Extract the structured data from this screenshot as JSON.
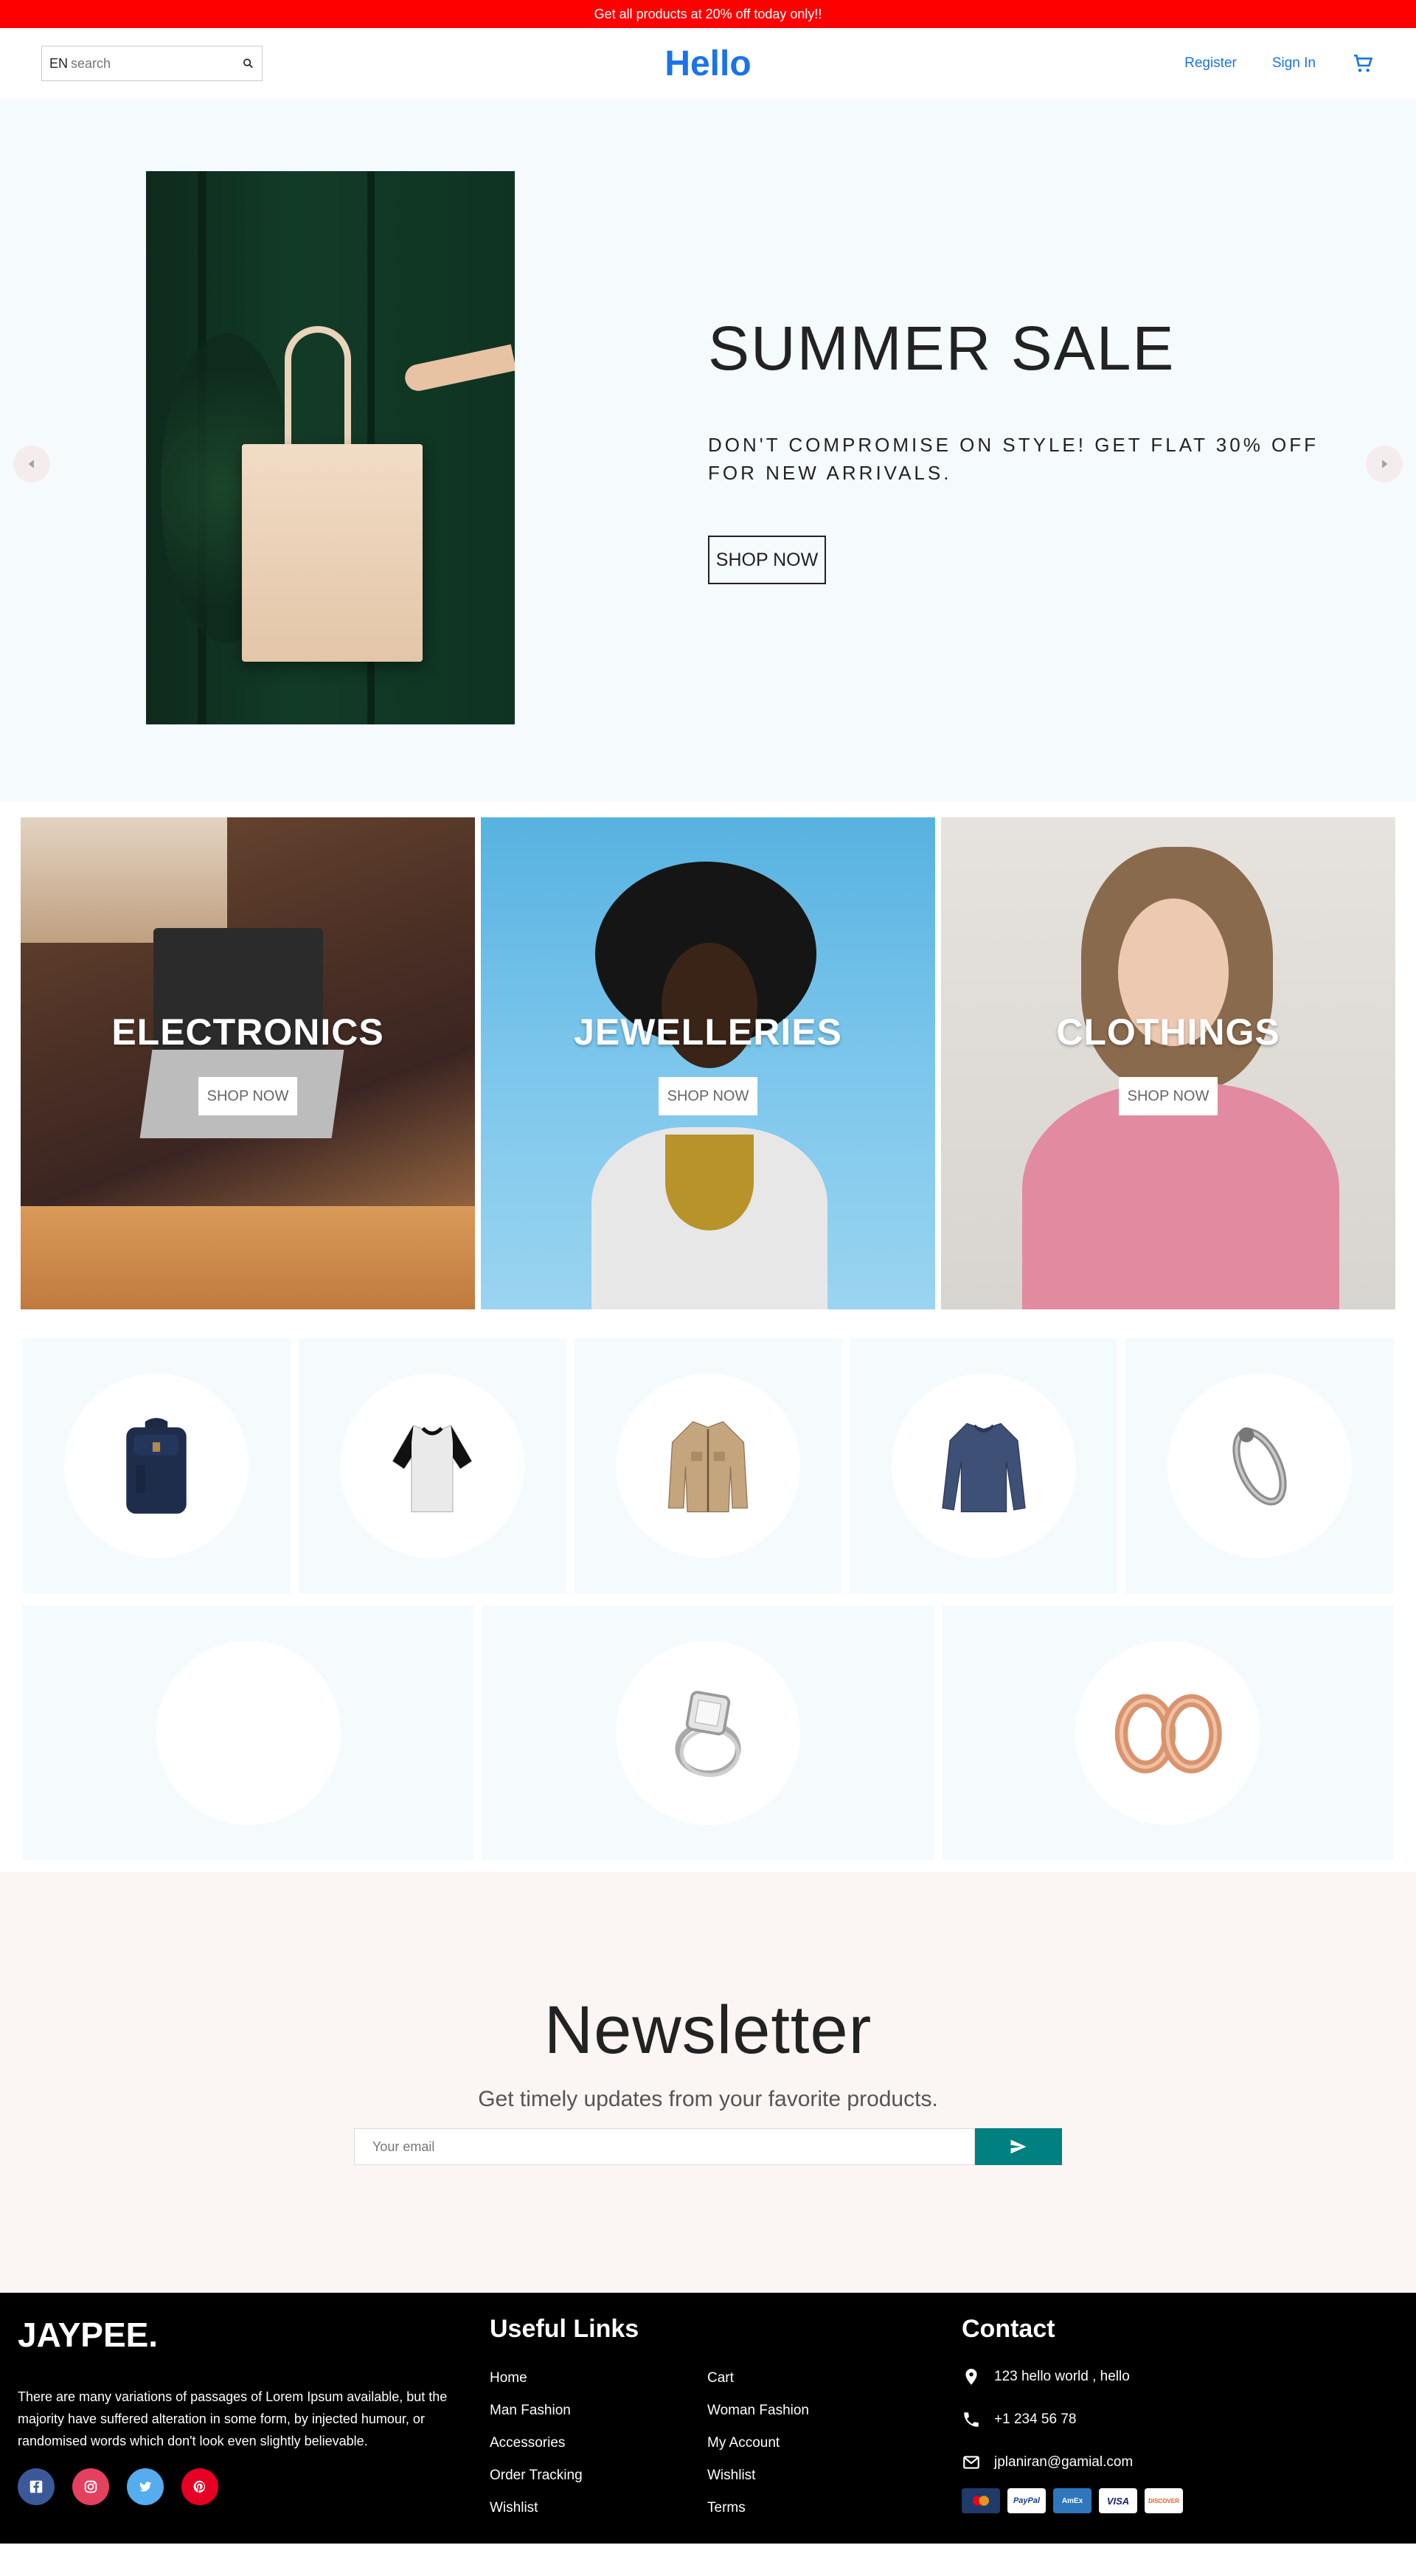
{
  "announcement": "Get all products at 20% off today only!!",
  "nav": {
    "lang": "EN",
    "search_placeholder": "search",
    "logo": "Hello",
    "register": "Register",
    "signin": "Sign In"
  },
  "hero": {
    "title": "SUMMER SALE",
    "subtitle": "DON'T COMPROMISE ON STYLE! GET FLAT 30% OFF FOR NEW ARRIVALS.",
    "button": "SHOP NOW"
  },
  "categories": [
    {
      "title": "ELECTRONICS",
      "button": "SHOP NOW"
    },
    {
      "title": "JEWELLERIES",
      "button": "SHOP NOW"
    },
    {
      "title": "CLOTHINGS",
      "button": "SHOP NOW"
    }
  ],
  "products": {
    "row1": [
      "backpack",
      "raglan-tshirt",
      "jacket",
      "long-sleeve-shirt",
      "bracelet"
    ],
    "row2": [
      "empty",
      "diamond-ring",
      "rose-gold-earrings"
    ]
  },
  "newsletter": {
    "title": "Newsletter",
    "subtitle": "Get timely updates from your favorite products.",
    "placeholder": "Your email"
  },
  "footer": {
    "logo": "JAYPEE.",
    "description": "There are many variations of passages of Lorem Ipsum available, but the majority have suffered alteration in some form, by injected humour, or randomised words which don't look even slightly believable.",
    "links_title": "Useful Links",
    "links": [
      "Home",
      "Cart",
      "Man Fashion",
      "Woman Fashion",
      "Accessories",
      "My Account",
      "Order Tracking",
      "Wishlist",
      "Wishlist",
      "Terms"
    ],
    "contact_title": "Contact",
    "address": "123 hello world , hello",
    "phone": "+1 234 56 78",
    "email": "jplaniran@gamial.com",
    "payments": [
      "MasterCard",
      "PayPal",
      "AmEx",
      "VISA",
      "DISCOVER"
    ]
  },
  "colors": {
    "announcement": "#ff0000",
    "brand": "#1a73e8",
    "hero_bg": "#f5fafd",
    "newsletter_bg": "#fbf5f3",
    "send_button": "#008080",
    "facebook": "#3b5999",
    "instagram": "#e4405f",
    "twitter": "#55acee",
    "pinterest": "#e60023"
  }
}
